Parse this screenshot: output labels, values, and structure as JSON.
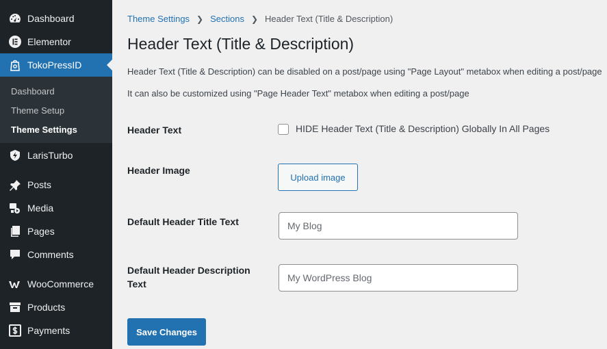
{
  "sidebar": {
    "items_top": [
      {
        "label": "Dashboard",
        "icon": "dashboard-icon"
      },
      {
        "label": "Elementor",
        "icon": "elementor-icon"
      },
      {
        "label": "TokoPressID",
        "icon": "tokopress-icon"
      }
    ],
    "submenu": [
      {
        "label": "Dashboard"
      },
      {
        "label": "Theme Setup"
      },
      {
        "label": "Theme Settings"
      }
    ],
    "items_bottom": [
      {
        "label": "LarisTurbo",
        "icon": "laristurbo-icon"
      },
      {
        "label": "Posts",
        "icon": "pushpin-icon"
      },
      {
        "label": "Media",
        "icon": "media-icon"
      },
      {
        "label": "Pages",
        "icon": "pages-icon"
      },
      {
        "label": "Comments",
        "icon": "comment-icon"
      },
      {
        "label": "WooCommerce",
        "icon": "woocommerce-icon"
      },
      {
        "label": "Products",
        "icon": "archive-icon"
      },
      {
        "label": "Payments",
        "icon": "payments-icon"
      }
    ]
  },
  "breadcrumb": {
    "link1": "Theme Settings",
    "link2": "Sections",
    "current": "Header Text (Title & Description)"
  },
  "page": {
    "title": "Header Text (Title & Description)",
    "desc1": "Header Text (Title & Description) can be disabled on a post/page using \"Page Layout\" metabox when editing a post/page",
    "desc2": "It can also be customized using \"Page Header Text\" metabox when editing a post/page"
  },
  "form": {
    "header_text_label": "Header Text",
    "hide_checkbox_label": "HIDE Header Text (Title & Description) Globally In All Pages",
    "hide_checked": false,
    "header_image_label": "Header Image",
    "upload_button": "Upload image",
    "title_text_label": "Default Header Title Text",
    "title_text_placeholder": "My Blog",
    "desc_text_label_line1": "Default Header Description",
    "desc_text_label_line2": "Text",
    "desc_text_placeholder": "My WordPress Blog",
    "save_button": "Save Changes"
  },
  "colors": {
    "sidebar_bg": "#1d2327",
    "accent": "#2271b1",
    "page_bg": "#f0f0f1"
  }
}
